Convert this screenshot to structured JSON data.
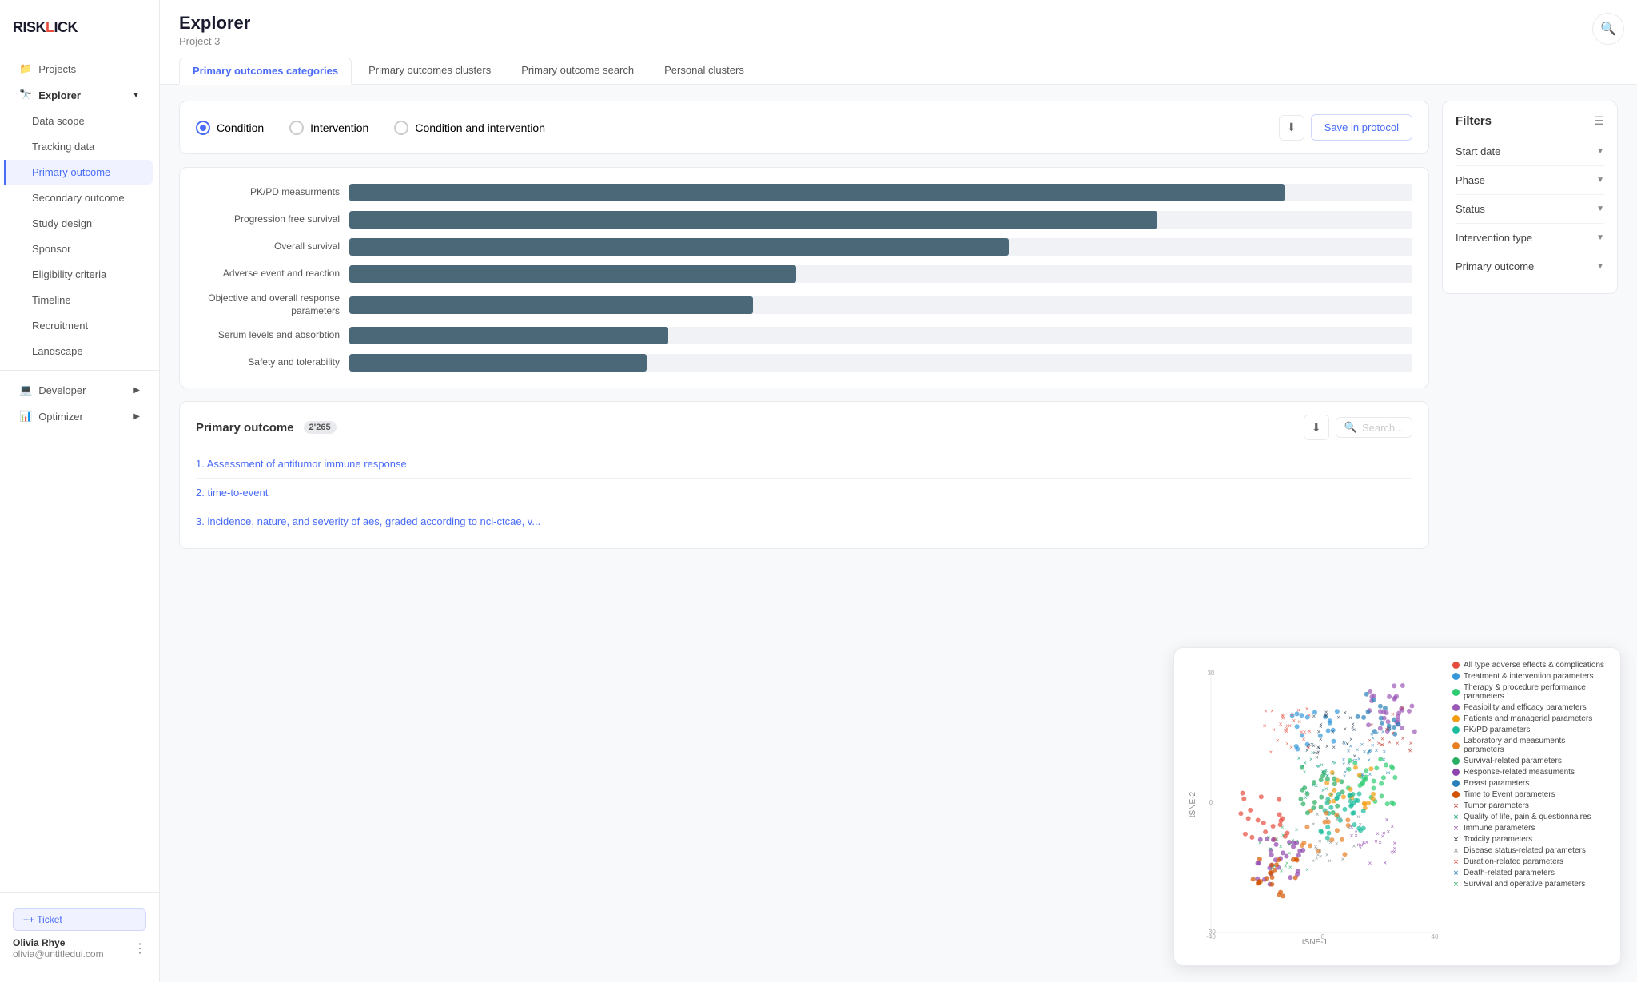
{
  "app": {
    "logo": "RISKLICK",
    "logo_dot_color": "#e74c3c"
  },
  "sidebar": {
    "nav": [
      {
        "id": "projects",
        "label": "Projects",
        "icon": "📁",
        "level": "top"
      },
      {
        "id": "explorer",
        "label": "Explorer",
        "icon": "🔭",
        "level": "top",
        "expanded": true,
        "active": false
      },
      {
        "id": "data-scope",
        "label": "Data scope",
        "level": "sub"
      },
      {
        "id": "tracking-data",
        "label": "Tracking data",
        "level": "sub"
      },
      {
        "id": "primary-outcome",
        "label": "Primary outcome",
        "level": "sub",
        "active": true
      },
      {
        "id": "secondary-outcome",
        "label": "Secondary outcome",
        "level": "sub"
      },
      {
        "id": "study-design",
        "label": "Study design",
        "level": "sub"
      },
      {
        "id": "sponsor",
        "label": "Sponsor",
        "level": "sub"
      },
      {
        "id": "eligibility-criteria",
        "label": "Eligibility criteria",
        "level": "sub"
      },
      {
        "id": "timeline",
        "label": "Timeline",
        "level": "sub"
      },
      {
        "id": "recruitment",
        "label": "Recruitment",
        "level": "sub"
      },
      {
        "id": "landscape",
        "label": "Landscape",
        "level": "sub"
      },
      {
        "id": "developer",
        "label": "Developer",
        "icon": "💻",
        "level": "top"
      },
      {
        "id": "optimizer",
        "label": "Optimizer",
        "icon": "📊",
        "level": "top"
      }
    ],
    "ticket_label": "+ Ticket",
    "user": {
      "name": "Olivia Rhye",
      "email": "olivia@untitledui.com"
    }
  },
  "page": {
    "title": "Explorer",
    "subtitle": "Project 3",
    "search_icon": "🔍"
  },
  "tabs": [
    {
      "id": "primary-outcomes-categories",
      "label": "Primary outcomes categories",
      "active": true
    },
    {
      "id": "primary-outcomes-clusters",
      "label": "Primary outcomes clusters",
      "active": false
    },
    {
      "id": "primary-outcome-search",
      "label": "Primary outcome search",
      "active": false
    },
    {
      "id": "personal-clusters",
      "label": "Personal clusters",
      "active": false
    }
  ],
  "radio_group": {
    "options": [
      {
        "id": "condition",
        "label": "Condition",
        "checked": true
      },
      {
        "id": "intervention",
        "label": "Intervention",
        "checked": false
      },
      {
        "id": "condition-and-intervention",
        "label": "Condition and intervention",
        "checked": false
      }
    ],
    "save_label": "Save in protocol"
  },
  "bar_chart": {
    "bars": [
      {
        "label": "PK/PD measurments",
        "value": 88,
        "width_pct": 88
      },
      {
        "label": "Progression free survival",
        "value": 76,
        "width_pct": 76
      },
      {
        "label": "Overall survival",
        "value": 62,
        "width_pct": 62
      },
      {
        "label": "Adverse event and reaction",
        "value": 42,
        "width_pct": 42
      },
      {
        "label": "Objective and overall response parameters",
        "value": 38,
        "width_pct": 38
      },
      {
        "label": "Serum levels and absorbtion",
        "value": 30,
        "width_pct": 30
      },
      {
        "label": "Safety and tolerability",
        "value": 28,
        "width_pct": 28
      }
    ]
  },
  "outcome_list": {
    "title": "Primary outcome",
    "count": "2'265",
    "items": [
      {
        "num": 1,
        "text": "Assessment of antitumor immune response"
      },
      {
        "num": 2,
        "text": "time-to-event"
      },
      {
        "num": 3,
        "text": "incidence, nature, and severity of aes, graded according to nci-ctcae, v..."
      }
    ],
    "search_placeholder": "Search..."
  },
  "filters": {
    "title": "Filters",
    "items": [
      {
        "id": "start-date",
        "label": "Start date"
      },
      {
        "id": "phase",
        "label": "Phase"
      },
      {
        "id": "status",
        "label": "Status"
      },
      {
        "id": "intervention-type",
        "label": "Intervention type"
      },
      {
        "id": "primary-outcome",
        "label": "Primary outcome"
      }
    ]
  },
  "scatter": {
    "x_label": "tSNE-1",
    "y_label": "tSNE-2",
    "legend": [
      {
        "type": "circle",
        "color": "#e74c3c",
        "label": "All type adverse effects & complications"
      },
      {
        "type": "circle",
        "color": "#3498db",
        "label": "Treatment & intervention parameters"
      },
      {
        "type": "circle",
        "color": "#2ecc71",
        "label": "Therapy & procedure performance parameters"
      },
      {
        "type": "circle",
        "color": "#9b59b6",
        "label": "Feasibility and efficacy parameters"
      },
      {
        "type": "circle",
        "color": "#f39c12",
        "label": "Patients and managerial parameters"
      },
      {
        "type": "circle",
        "color": "#1abc9c",
        "label": "PK/PD parameters"
      },
      {
        "type": "circle",
        "color": "#e67e22",
        "label": "Laboratory and measuments parameters"
      },
      {
        "type": "circle",
        "color": "#27ae60",
        "label": "Survival-related parameters"
      },
      {
        "type": "circle",
        "color": "#8e44ad",
        "label": "Response-related measuments"
      },
      {
        "type": "circle",
        "color": "#2980b9",
        "label": "Breast parameters"
      },
      {
        "type": "circle",
        "color": "#d35400",
        "label": "Time to Event parameters"
      },
      {
        "type": "x",
        "color": "#c0392b",
        "label": "Tumor parameters"
      },
      {
        "type": "x",
        "color": "#16a085",
        "label": "Quality of life, pain & questionnaires"
      },
      {
        "type": "x",
        "color": "#8e44ad",
        "label": "Immune parameters"
      },
      {
        "type": "x",
        "color": "#2c3e50",
        "label": "Toxicity parameters"
      },
      {
        "type": "x",
        "color": "#7f8c8d",
        "label": "Disease status-related parameters"
      },
      {
        "type": "x",
        "color": "#e74c3c",
        "label": "Duration-related parameters"
      },
      {
        "type": "x",
        "color": "#2980b9",
        "label": "Death-related parameters"
      },
      {
        "type": "x",
        "color": "#27ae60",
        "label": "Survival and operative parameters"
      }
    ]
  }
}
